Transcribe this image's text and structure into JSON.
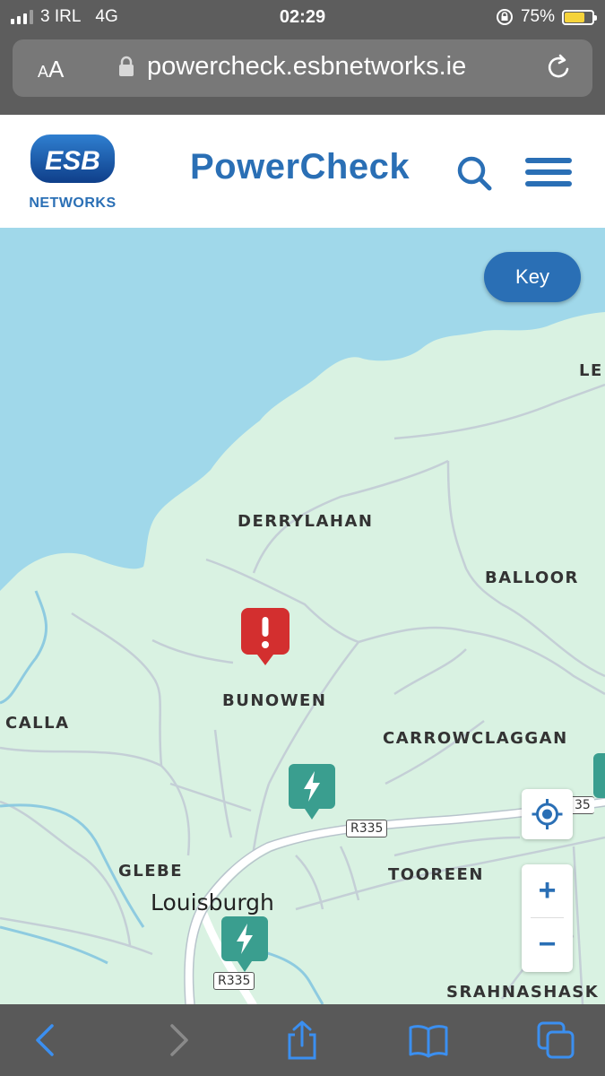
{
  "status_bar": {
    "carrier": "3 IRL",
    "network": "4G",
    "time": "02:29",
    "battery_percent": "75%",
    "battery_level": 0.75
  },
  "browser": {
    "text_size_label": "AA",
    "url": "powercheck.esbnetworks.ie"
  },
  "site": {
    "logo_text": "ESB",
    "logo_subtext": "NETWORKS",
    "title": "PowerCheck"
  },
  "map": {
    "key_label": "Key",
    "places": {
      "derrylahan": "DERRYLAHAN",
      "balloor": "BALLOOR",
      "bunowen": "BUNOWEN",
      "calla": "CALLA",
      "carrowclaggan": "CARROWCLAGGAN",
      "glebe": "GLEBE",
      "tooreen": "TOOREEN",
      "srahnashask": "SRAHNASHASK",
      "le": "LE"
    },
    "town": "Louisburgh",
    "roads": {
      "r335_a": "R335",
      "r335_b": "R335",
      "r335_c": "35"
    },
    "zoom_in": "+",
    "zoom_out": "−",
    "colors": {
      "sea": "#a0d8ea",
      "land": "#d9f2e2",
      "fault_marker": "#d32f2f",
      "restored_marker": "#3a9e8f",
      "accent": "#2a6fb5"
    }
  }
}
